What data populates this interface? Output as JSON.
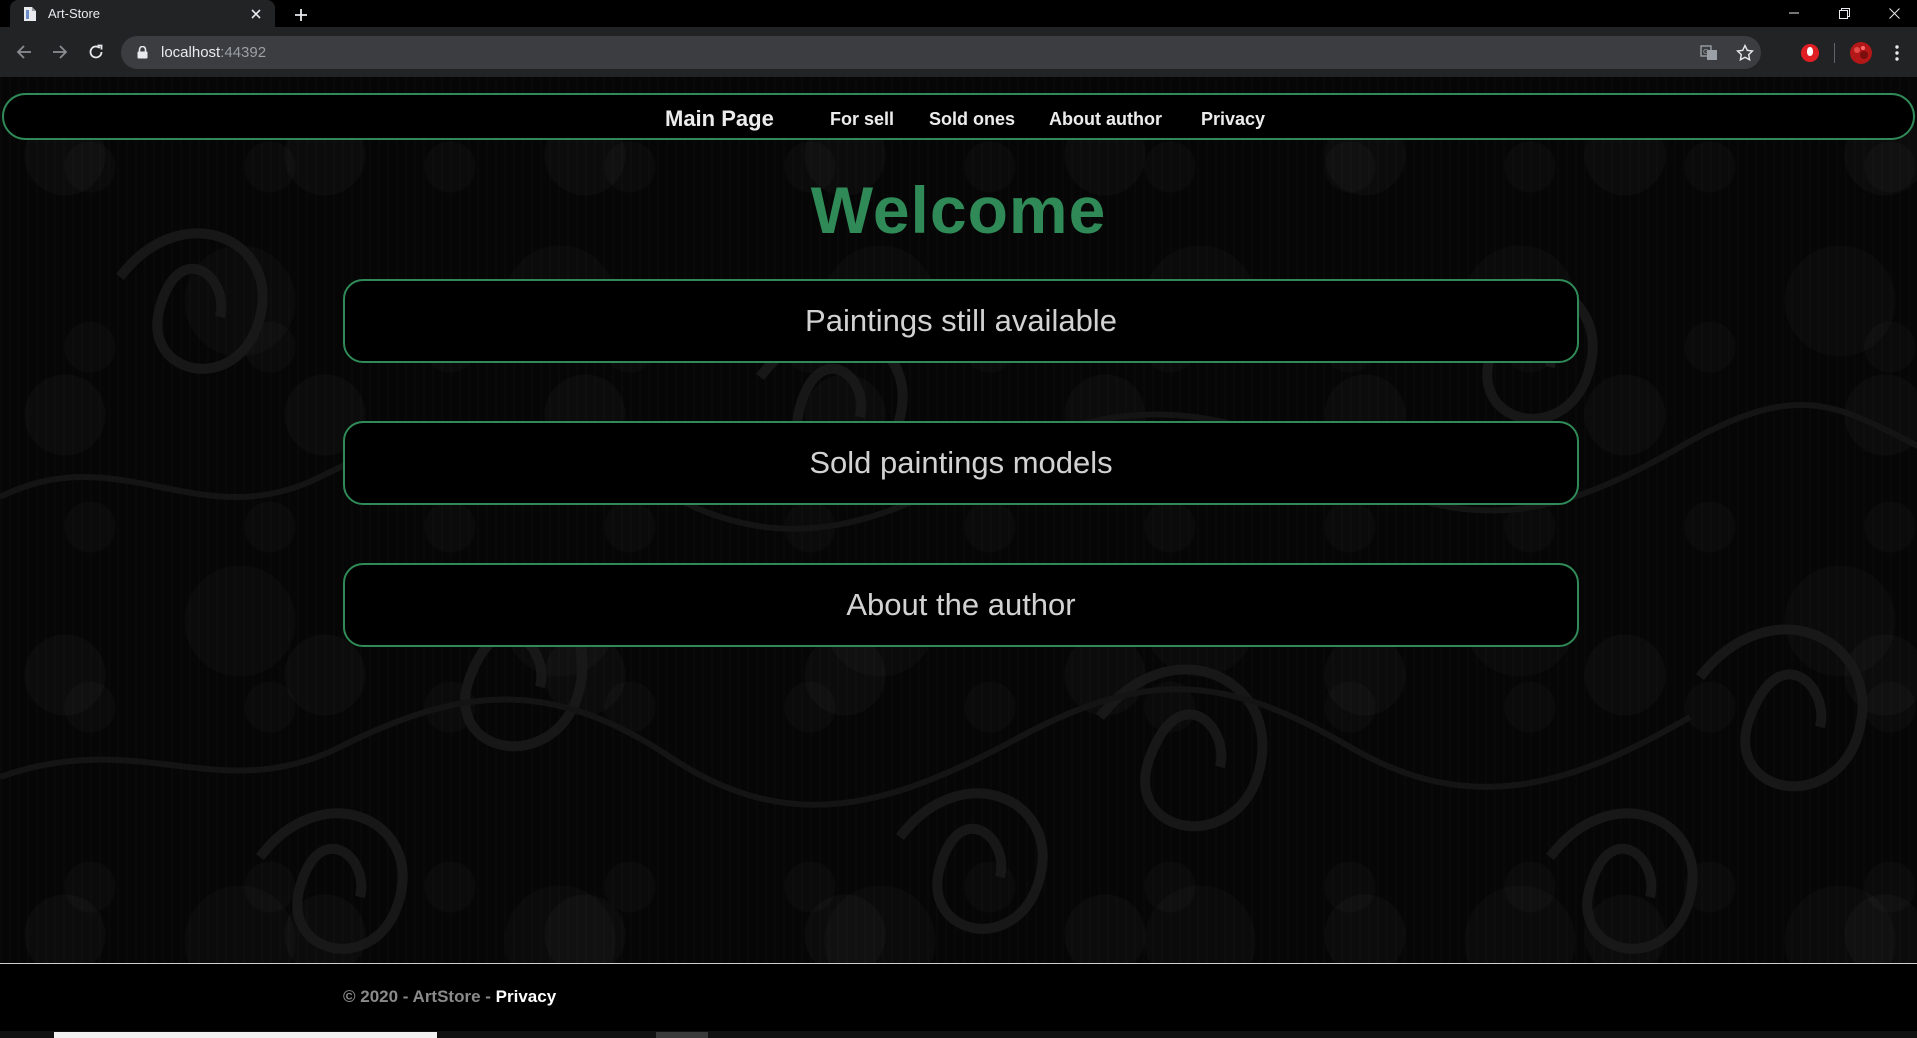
{
  "browser": {
    "tab_title": "Art-Store",
    "url_host": "localhost",
    "url_port": ":44392",
    "icons": [
      "page-icon",
      "close-icon",
      "plus-icon",
      "minimize-icon",
      "restore-icon",
      "window-close-icon",
      "back-icon",
      "forward-icon",
      "reload-icon",
      "lock-icon",
      "translate-icon",
      "star-icon",
      "extension-icon",
      "profile-icon",
      "menu-icon"
    ]
  },
  "nav": {
    "brand": "Main Page",
    "links": [
      "For sell",
      "Sold ones",
      "About author",
      "Privacy"
    ]
  },
  "main": {
    "heading": "Welcome",
    "buttons": [
      "Paintings still available",
      "Sold paintings models",
      "About the author"
    ]
  },
  "footer": {
    "copyright": "© 2020 - ArtStore - ",
    "privacy_link": "Privacy"
  },
  "colors": {
    "accent": "#2f8a57",
    "background": "#000000",
    "text": "#ececec"
  }
}
